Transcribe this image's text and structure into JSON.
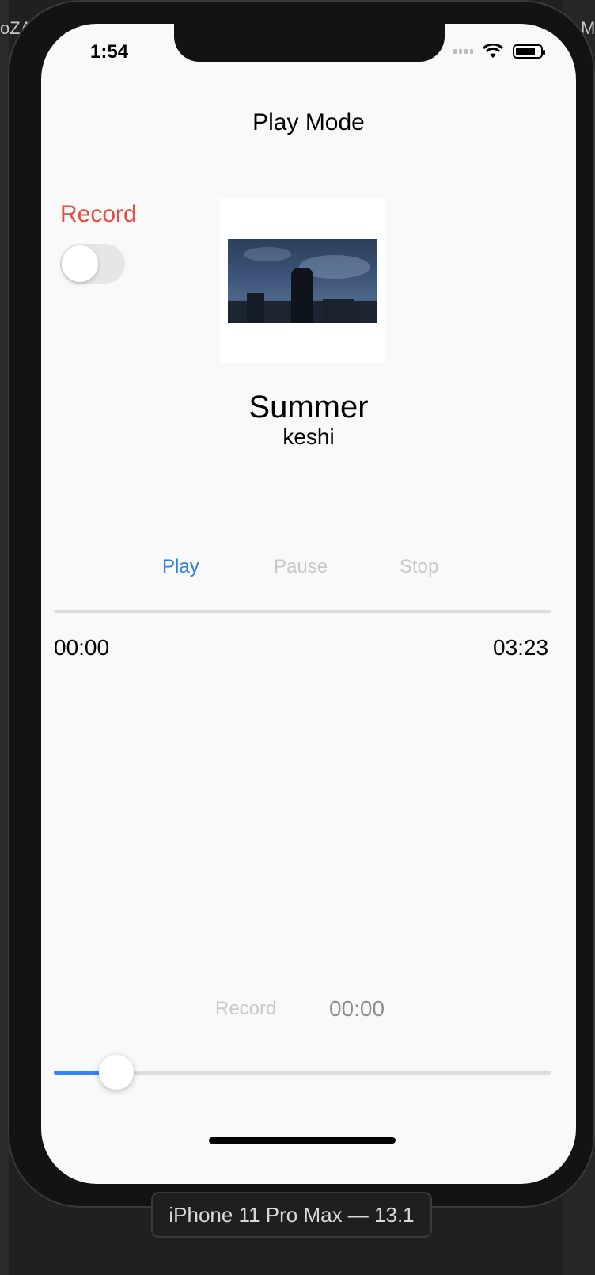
{
  "status_bar": {
    "time": "1:54"
  },
  "nav": {
    "title": "Play Mode"
  },
  "record_section": {
    "label": "Record",
    "toggle_on": false
  },
  "song": {
    "title": "Summer",
    "artist": "keshi"
  },
  "controls": {
    "play": "Play",
    "pause": "Pause",
    "stop": "Stop"
  },
  "progress": {
    "elapsed": "00:00",
    "duration": "03:23",
    "fraction": 0
  },
  "recording": {
    "label": "Record",
    "time": "00:00"
  },
  "volume": {
    "level": 0.13
  },
  "simulator": {
    "device_label": "iPhone 11 Pro Max — 13.1"
  },
  "colors": {
    "accent": "#2d7cf6",
    "record": "#e74c3c",
    "disabled": "#c8c8c8"
  },
  "background_fragments": {
    "left": "oZA",
    "right": "M"
  }
}
